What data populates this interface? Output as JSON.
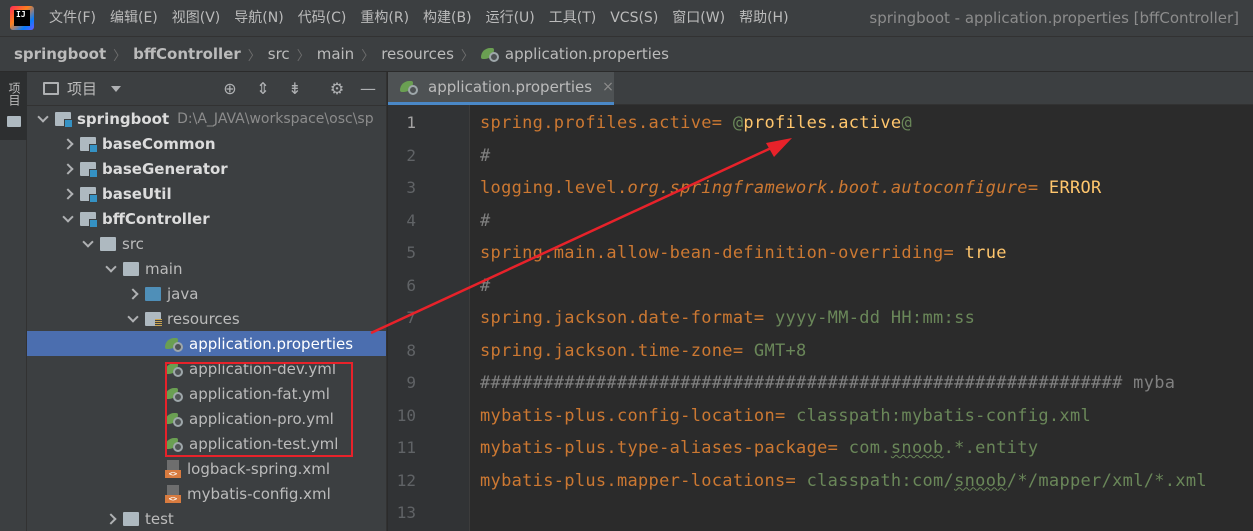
{
  "menubar": {
    "logo_text": "IJ",
    "items": [
      "文件(F)",
      "编辑(E)",
      "视图(V)",
      "导航(N)",
      "代码(C)",
      "重构(R)",
      "构建(B)",
      "运行(U)",
      "工具(T)",
      "VCS(S)",
      "窗口(W)",
      "帮助(H)"
    ],
    "window_title": "springboot - application.properties [bffController]"
  },
  "breadcrumb": [
    "springboot",
    "bffController",
    "src",
    "main",
    "resources",
    "application.properties"
  ],
  "tool_strip": {
    "label": "项目"
  },
  "project_panel": {
    "title": "项目",
    "header_icons": [
      "crosshair-icon",
      "expand-all-icon",
      "collapse-all-icon",
      "gear-icon",
      "minimize-icon"
    ],
    "tree": [
      {
        "name": "springboot",
        "path": "D:\\A_JAVA\\workspace\\osc\\sp",
        "expanded": true,
        "icon": "module-folder",
        "bold": true
      },
      {
        "name": "baseCommon",
        "expanded": false,
        "icon": "module-folder",
        "bold": true
      },
      {
        "name": "baseGenerator",
        "expanded": false,
        "icon": "module-folder",
        "bold": true
      },
      {
        "name": "baseUtil",
        "expanded": false,
        "icon": "module-folder",
        "bold": true
      },
      {
        "name": "bffController",
        "expanded": true,
        "icon": "module-folder",
        "bold": true
      },
      {
        "name": "src",
        "expanded": true,
        "icon": "folder"
      },
      {
        "name": "main",
        "expanded": true,
        "icon": "folder"
      },
      {
        "name": "java",
        "expanded": false,
        "icon": "source-folder"
      },
      {
        "name": "resources",
        "expanded": true,
        "icon": "resources-folder"
      },
      {
        "name": "application.properties",
        "icon": "spring-config",
        "selected": true
      },
      {
        "name": "application-dev.yml",
        "icon": "spring-config"
      },
      {
        "name": "application-fat.yml",
        "icon": "spring-config"
      },
      {
        "name": "application-pro.yml",
        "icon": "spring-config"
      },
      {
        "name": "application-test.yml",
        "icon": "spring-config"
      },
      {
        "name": "logback-spring.xml",
        "icon": "xml-file"
      },
      {
        "name": "mybatis-config.xml",
        "icon": "xml-file"
      },
      {
        "name": "test",
        "expanded": false,
        "icon": "folder"
      }
    ]
  },
  "editor": {
    "tab_label": "application.properties",
    "tab_close": "×",
    "line_numbers": [
      "1",
      "2",
      "3",
      "4",
      "5",
      "6",
      "7",
      "8",
      "9",
      "10",
      "11",
      "12",
      "13"
    ],
    "lines": [
      [
        {
          "t": "spring.profiles.active",
          "c": "k"
        },
        {
          "t": "= ",
          "c": "eq"
        },
        {
          "t": "@",
          "c": "v"
        },
        {
          "t": "profiles.active",
          "c": "vy"
        },
        {
          "t": "@",
          "c": "v"
        }
      ],
      [
        {
          "t": "#",
          "c": "c"
        }
      ],
      [
        {
          "t": "logging.level.",
          "c": "k"
        },
        {
          "t": "org.springframework.boot.autoconfigure",
          "c": "k it"
        },
        {
          "t": "= ",
          "c": "eq"
        },
        {
          "t": "ERROR",
          "c": "vy"
        }
      ],
      [
        {
          "t": "#",
          "c": "c"
        }
      ],
      [
        {
          "t": "spring.main.allow-bean-definition-overriding",
          "c": "k"
        },
        {
          "t": "= ",
          "c": "eq"
        },
        {
          "t": "true",
          "c": "vy"
        }
      ],
      [
        {
          "t": "#",
          "c": "c"
        }
      ],
      [
        {
          "t": "spring.jackson.date-format",
          "c": "k"
        },
        {
          "t": "= ",
          "c": "eq"
        },
        {
          "t": "yyyy-MM-dd HH:mm:ss",
          "c": "v"
        }
      ],
      [
        {
          "t": "spring.jackson.time-zone",
          "c": "k"
        },
        {
          "t": "= ",
          "c": "eq"
        },
        {
          "t": "GMT+8",
          "c": "v"
        }
      ],
      [
        {
          "t": "############################################################# myba",
          "c": "c"
        }
      ],
      [
        {
          "t": "mybatis-plus.config-location",
          "c": "k"
        },
        {
          "t": "= ",
          "c": "eq"
        },
        {
          "t": "classpath:mybatis-config.xml",
          "c": "v"
        }
      ],
      [
        {
          "t": "mybatis-plus.type-aliases-package",
          "c": "k"
        },
        {
          "t": "= ",
          "c": "eq"
        },
        {
          "t": "com.",
          "c": "v"
        },
        {
          "t": "snoob",
          "c": "v sq"
        },
        {
          "t": ".*.entity",
          "c": "v"
        }
      ],
      [
        {
          "t": "mybatis-plus.mapper-locations",
          "c": "k"
        },
        {
          "t": "= ",
          "c": "eq"
        },
        {
          "t": "classpath:com/",
          "c": "v"
        },
        {
          "t": "snoob",
          "c": "v sq"
        },
        {
          "t": "/*/mapper/xml/*.xml",
          "c": "v"
        }
      ],
      []
    ]
  },
  "colors": {
    "annotation_red": "#e8222a",
    "selection_blue": "#4b6eaf",
    "key_orange": "#cc7832",
    "value_green": "#6a8759",
    "value_yellow": "#ffc66d"
  }
}
